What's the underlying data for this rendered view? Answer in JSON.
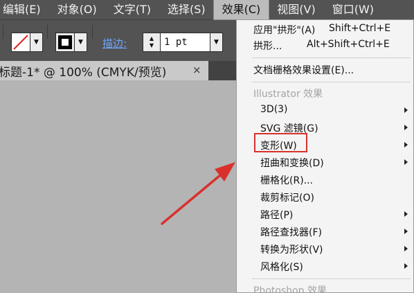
{
  "menubar": {
    "items": [
      {
        "label": "编辑(E)"
      },
      {
        "label": "对象(O)"
      },
      {
        "label": "文字(T)"
      },
      {
        "label": "选择(S)"
      },
      {
        "label": "效果(C)"
      },
      {
        "label": "视图(V)"
      },
      {
        "label": "窗口(W)"
      }
    ]
  },
  "controlbar": {
    "stroke_label": "描边:",
    "stroke_weight": "1 pt"
  },
  "document_tab": {
    "title": "标题-1* @ 100% (CMYK/预览)",
    "close_glyph": "×"
  },
  "effect_menu": {
    "apply_last": {
      "label": "应用\"拱形\"(A)",
      "shortcut": "Shift+Ctrl+E"
    },
    "last_effect": {
      "label": "拱形...",
      "shortcut": "Alt+Shift+Ctrl+E"
    },
    "raster_settings": {
      "label": "文档栅格效果设置(E)..."
    },
    "illustrator_header": "Illustrator 效果",
    "illustrator_items": [
      {
        "label": "3D(3)"
      },
      {
        "label": "SVG 滤镜(G)"
      },
      {
        "label": "变形(W)"
      },
      {
        "label": "扭曲和变换(D)"
      },
      {
        "label": "栅格化(R)..."
      },
      {
        "label": "裁剪标记(O)"
      },
      {
        "label": "路径(P)"
      },
      {
        "label": "路径查找器(F)"
      },
      {
        "label": "转换为形状(V)"
      },
      {
        "label": "风格化(S)"
      }
    ],
    "photoshop_header": "Photoshop 效果"
  },
  "annotation": {
    "highlight_color": "#d9302c"
  }
}
